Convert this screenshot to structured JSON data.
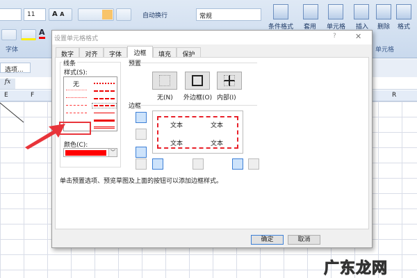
{
  "ribbon": {
    "font_size": "11",
    "grow_font": "A",
    "shrink_font": "A",
    "wrap_text": "自动换行",
    "number_format": "常规",
    "conditional_format": "条件格式",
    "table_format": "套用",
    "cell_style": "单元格",
    "insert": "插入",
    "delete": "删除",
    "format": "格式",
    "group_font": "字体",
    "group_cells": "单元格",
    "options_button": "选项...",
    "fx": "fx"
  },
  "columns": [
    "E",
    "F",
    "R"
  ],
  "dialog": {
    "title": "设置单元格格式",
    "help": "?",
    "close": "✕",
    "tabs": [
      "数字",
      "对齐",
      "字体",
      "边框",
      "填充",
      "保护"
    ],
    "active_tab": "边框",
    "line_group": "线条",
    "style_label": "样式(S):",
    "style_none": "无",
    "color_label": "颜色(C):",
    "color_value": "#ff0000",
    "presets_group": "预置",
    "presets": [
      "无(N)",
      "外边框(O)",
      "内部(I)"
    ],
    "border_group": "边框",
    "preview_text": [
      "文本",
      "文本",
      "文本",
      "文本"
    ],
    "hint": "单击预置选项、预览草图及上面的按钮可以添加边框样式。",
    "ok": "确定",
    "cancel": "取消"
  },
  "watermark": "广东龙网"
}
